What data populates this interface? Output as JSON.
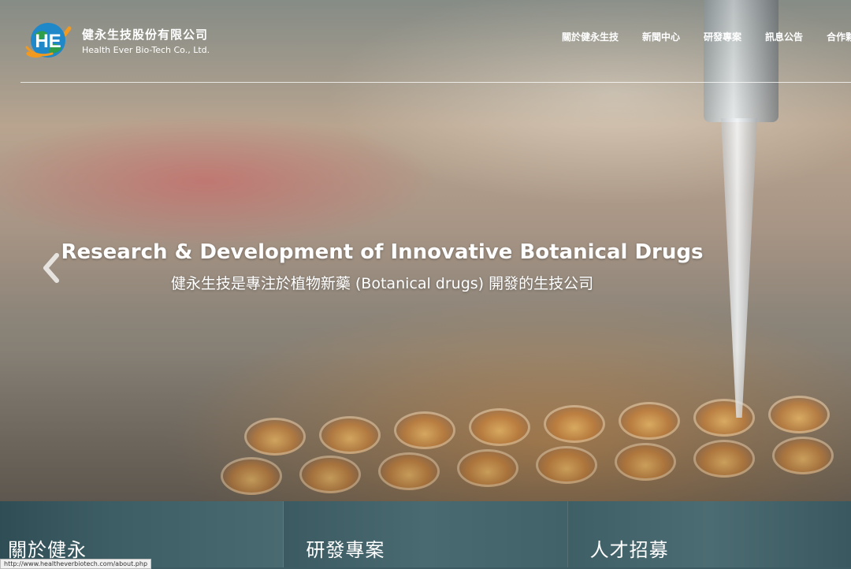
{
  "logo": {
    "mark_letters": "HE",
    "name_cn": "健永生技股份有限公司",
    "name_en": "Health Ever Bio-Tech Co., Ltd."
  },
  "nav": {
    "items": [
      {
        "label": "關於健永生技"
      },
      {
        "label": "新聞中心"
      },
      {
        "label": "研發專案"
      },
      {
        "label": "訊息公告"
      },
      {
        "label": "合作夥伴"
      }
    ]
  },
  "hero": {
    "title": "Research & Development of Innovative Botanical Drugs",
    "subtitle": "健永生技是專注於植物新藥 (Botanical drugs) 開發的生技公司",
    "prev_icon": "chevron-left-icon"
  },
  "tiles": [
    {
      "label": "關於健永"
    },
    {
      "label": "研發專案"
    },
    {
      "label": "人才招募"
    }
  ],
  "status_bar": {
    "url": "http://www.healtheverbiotech.com/about.php"
  },
  "colors": {
    "tile_bg": "#3e5e66",
    "logo_blue": "#1e88c8",
    "logo_green": "#2e9e4a",
    "logo_orange": "#f29a1f"
  }
}
